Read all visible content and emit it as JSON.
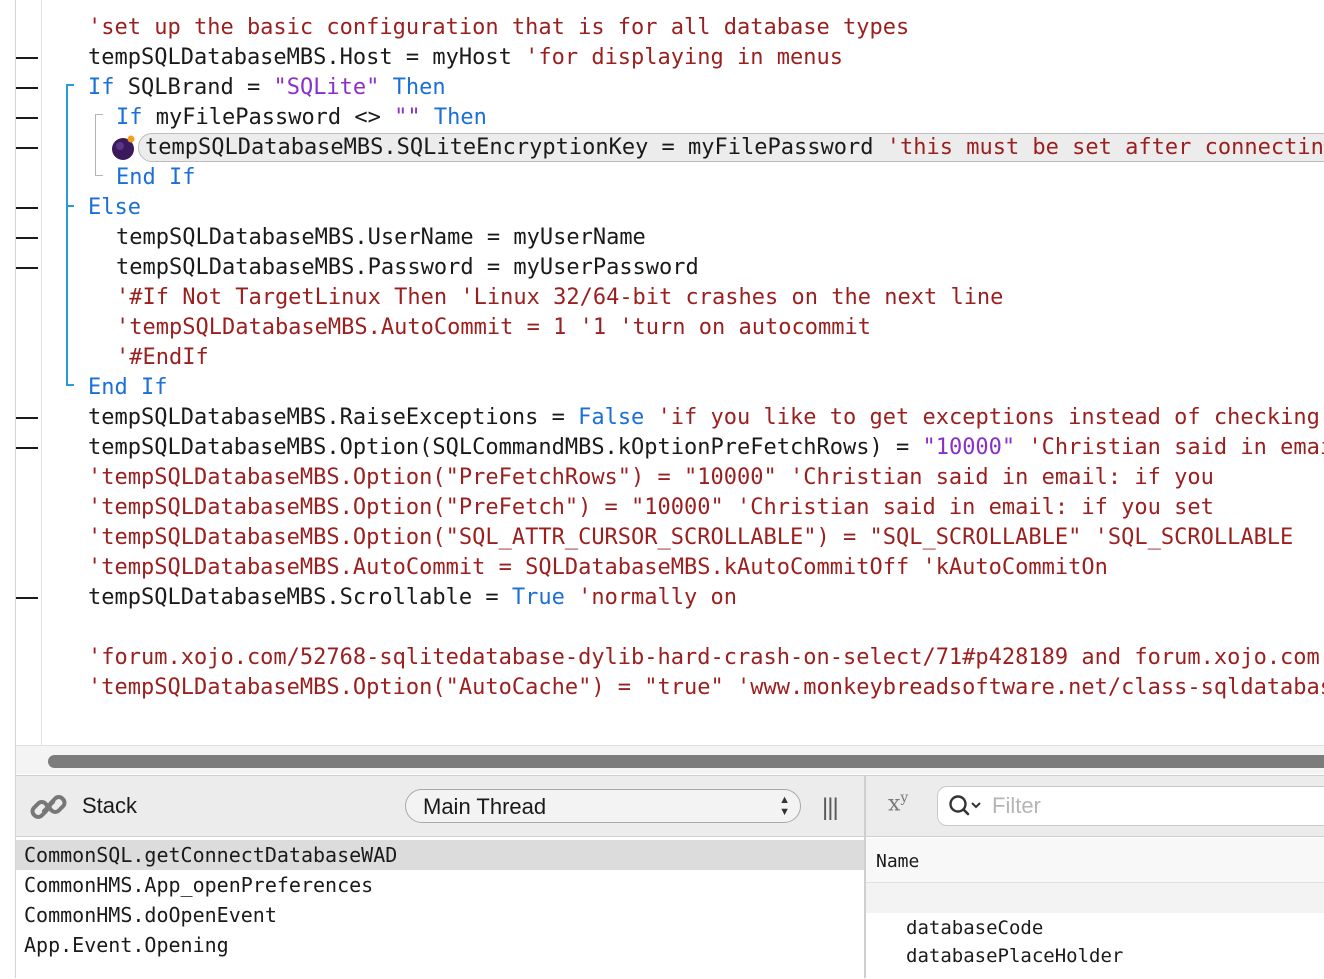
{
  "editor": {
    "lines": [
      {
        "mark": false,
        "indent": 0,
        "tokens": [
          [
            "com",
            "'set up the basic configuration that is for all database types"
          ]
        ]
      },
      {
        "mark": true,
        "indent": 0,
        "tokens": [
          [
            "plain",
            "tempSQLDatabaseMBS.Host = myHost "
          ],
          [
            "com",
            "'for displaying in menus"
          ]
        ]
      },
      {
        "mark": true,
        "indent": 0,
        "tokens": [
          [
            "kw",
            "If"
          ],
          [
            "plain",
            " SQLBrand = "
          ],
          [
            "str",
            "\"SQLite\""
          ],
          [
            "plain",
            " "
          ],
          [
            "kw",
            "Then"
          ]
        ]
      },
      {
        "mark": true,
        "indent": 1,
        "tokens": [
          [
            "kw",
            "If"
          ],
          [
            "plain",
            " myFilePassword <> "
          ],
          [
            "str",
            "\"\""
          ],
          [
            "plain",
            " "
          ],
          [
            "kw",
            "Then"
          ]
        ]
      },
      {
        "mark": true,
        "indent": 2,
        "tokens": [
          [
            "plain",
            "tempSQLDatabaseMBS.SQLiteEncryptionKey = myFilePassword "
          ],
          [
            "com",
            "'this must be set after connecting"
          ]
        ]
      },
      {
        "mark": false,
        "indent": 1,
        "tokens": [
          [
            "kw",
            "End If"
          ]
        ]
      },
      {
        "mark": true,
        "indent": 0,
        "tokens": [
          [
            "kw",
            "Else"
          ]
        ]
      },
      {
        "mark": true,
        "indent": 1,
        "tokens": [
          [
            "plain",
            "tempSQLDatabaseMBS.UserName = myUserName"
          ]
        ]
      },
      {
        "mark": true,
        "indent": 1,
        "tokens": [
          [
            "plain",
            "tempSQLDatabaseMBS.Password = myUserPassword"
          ]
        ]
      },
      {
        "mark": false,
        "indent": 1,
        "tokens": [
          [
            "com",
            "'#If Not TargetLinux Then 'Linux 32/64-bit crashes on the next line"
          ]
        ]
      },
      {
        "mark": false,
        "indent": 1,
        "tokens": [
          [
            "com",
            "'tempSQLDatabaseMBS.AutoCommit = 1 '1 'turn on autocommit"
          ]
        ]
      },
      {
        "mark": false,
        "indent": 1,
        "tokens": [
          [
            "com",
            "'#EndIf"
          ]
        ]
      },
      {
        "mark": false,
        "indent": 0,
        "tokens": [
          [
            "kw",
            "End If"
          ]
        ]
      },
      {
        "mark": true,
        "indent": 0,
        "tokens": [
          [
            "plain",
            "tempSQLDatabaseMBS.RaiseExceptions = "
          ],
          [
            "kw",
            "False"
          ],
          [
            "plain",
            " "
          ],
          [
            "com",
            "'if you like to get exceptions instead of checking"
          ]
        ]
      },
      {
        "mark": true,
        "indent": 0,
        "tokens": [
          [
            "plain",
            "tempSQLDatabaseMBS.Option(SQLCommandMBS.kOptionPreFetchRows) = "
          ],
          [
            "str",
            "\"10000\""
          ],
          [
            "plain",
            " "
          ],
          [
            "com",
            "'Christian said in email"
          ]
        ]
      },
      {
        "mark": false,
        "indent": 0,
        "tokens": [
          [
            "com",
            "'tempSQLDatabaseMBS.Option(\"PreFetchRows\") = \"10000\" 'Christian said in email: if you"
          ]
        ]
      },
      {
        "mark": false,
        "indent": 0,
        "tokens": [
          [
            "com",
            "'tempSQLDatabaseMBS.Option(\"PreFetch\") = \"10000\" 'Christian said in email: if you set"
          ]
        ]
      },
      {
        "mark": false,
        "indent": 0,
        "tokens": [
          [
            "com",
            "'tempSQLDatabaseMBS.Option(\"SQL_ATTR_CURSOR_SCROLLABLE\") = \"SQL_SCROLLABLE\" 'SQL_SCROLLABLE"
          ]
        ]
      },
      {
        "mark": false,
        "indent": 0,
        "tokens": [
          [
            "com",
            "'tempSQLDatabaseMBS.AutoCommit = SQLDatabaseMBS.kAutoCommitOff 'kAutoCommitOn"
          ]
        ]
      },
      {
        "mark": true,
        "indent": 0,
        "tokens": [
          [
            "plain",
            "tempSQLDatabaseMBS.Scrollable = "
          ],
          [
            "kw",
            "True"
          ],
          [
            "plain",
            " "
          ],
          [
            "com",
            "'normally on"
          ]
        ]
      },
      {
        "mark": false,
        "indent": 0,
        "tokens": []
      },
      {
        "mark": false,
        "indent": 0,
        "tokens": [
          [
            "com",
            "'forum.xojo.com/52768-sqlitedatabase-dylib-hard-crash-on-select/71#p428189 and forum.xojo.com"
          ]
        ]
      },
      {
        "mark": false,
        "indent": 0,
        "tokens": [
          [
            "com",
            "'tempSQLDatabaseMBS.Option(\"AutoCache\") = \"true\" 'www.monkeybreadsoftware.net/class-sqldatabasembs"
          ]
        ]
      }
    ],
    "colors": {
      "keyword": "#1b6fd8",
      "string": "#8b2fc9",
      "comment": "#9a1f1f",
      "plain": "#1a1a1a",
      "bracket": "#2a9bd6"
    },
    "breakpoint_icon": "bug-marker-icon"
  },
  "stack": {
    "label": "Stack",
    "thread": "Main Thread",
    "frames": [
      "CommonSQL.getConnectDatabaseWAD",
      "CommonHMS.App_openPreferences",
      "CommonHMS.doOpenEvent",
      "App.Event.Opening"
    ],
    "selected_index": 0
  },
  "variables": {
    "filter_placeholder": "Filter",
    "column_name": "Name",
    "items": [
      "databaseCode",
      "databasePlaceHolder"
    ]
  }
}
